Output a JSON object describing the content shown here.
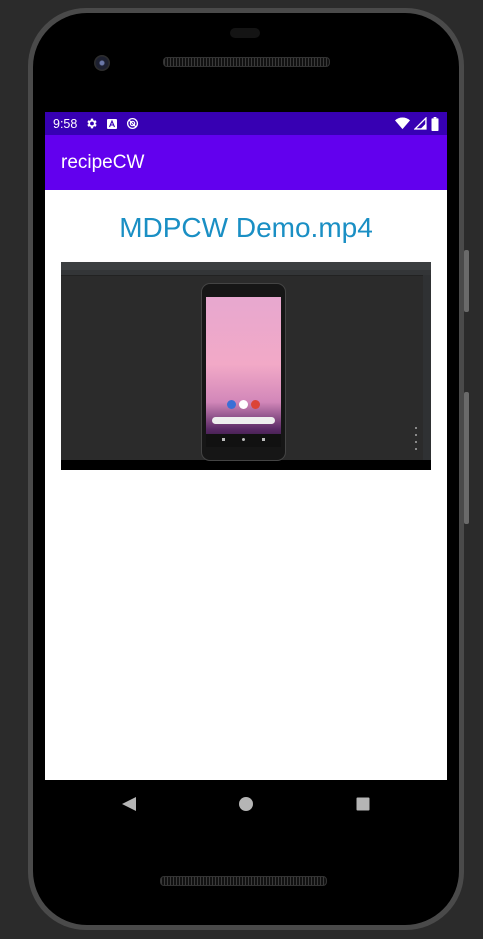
{
  "status_bar": {
    "time": "9:58",
    "left_icons": [
      "gear-icon",
      "storage-a-icon",
      "sync-circle-icon"
    ],
    "right_icons": [
      "wifi-icon",
      "signal-icon",
      "battery-icon"
    ]
  },
  "app_bar": {
    "title": "recipeCW"
  },
  "main": {
    "video_title": "MDPCW Demo.mp4",
    "video_thumbnail": "emulator-demo-video-frame"
  },
  "navigation_bar": {
    "buttons": [
      "back-icon",
      "home-icon",
      "recents-icon"
    ]
  },
  "colors": {
    "status_bar": "#3700B3",
    "app_bar": "#6200EE",
    "title_text": "#1a8fc4",
    "screen_background": "#ffffff"
  }
}
